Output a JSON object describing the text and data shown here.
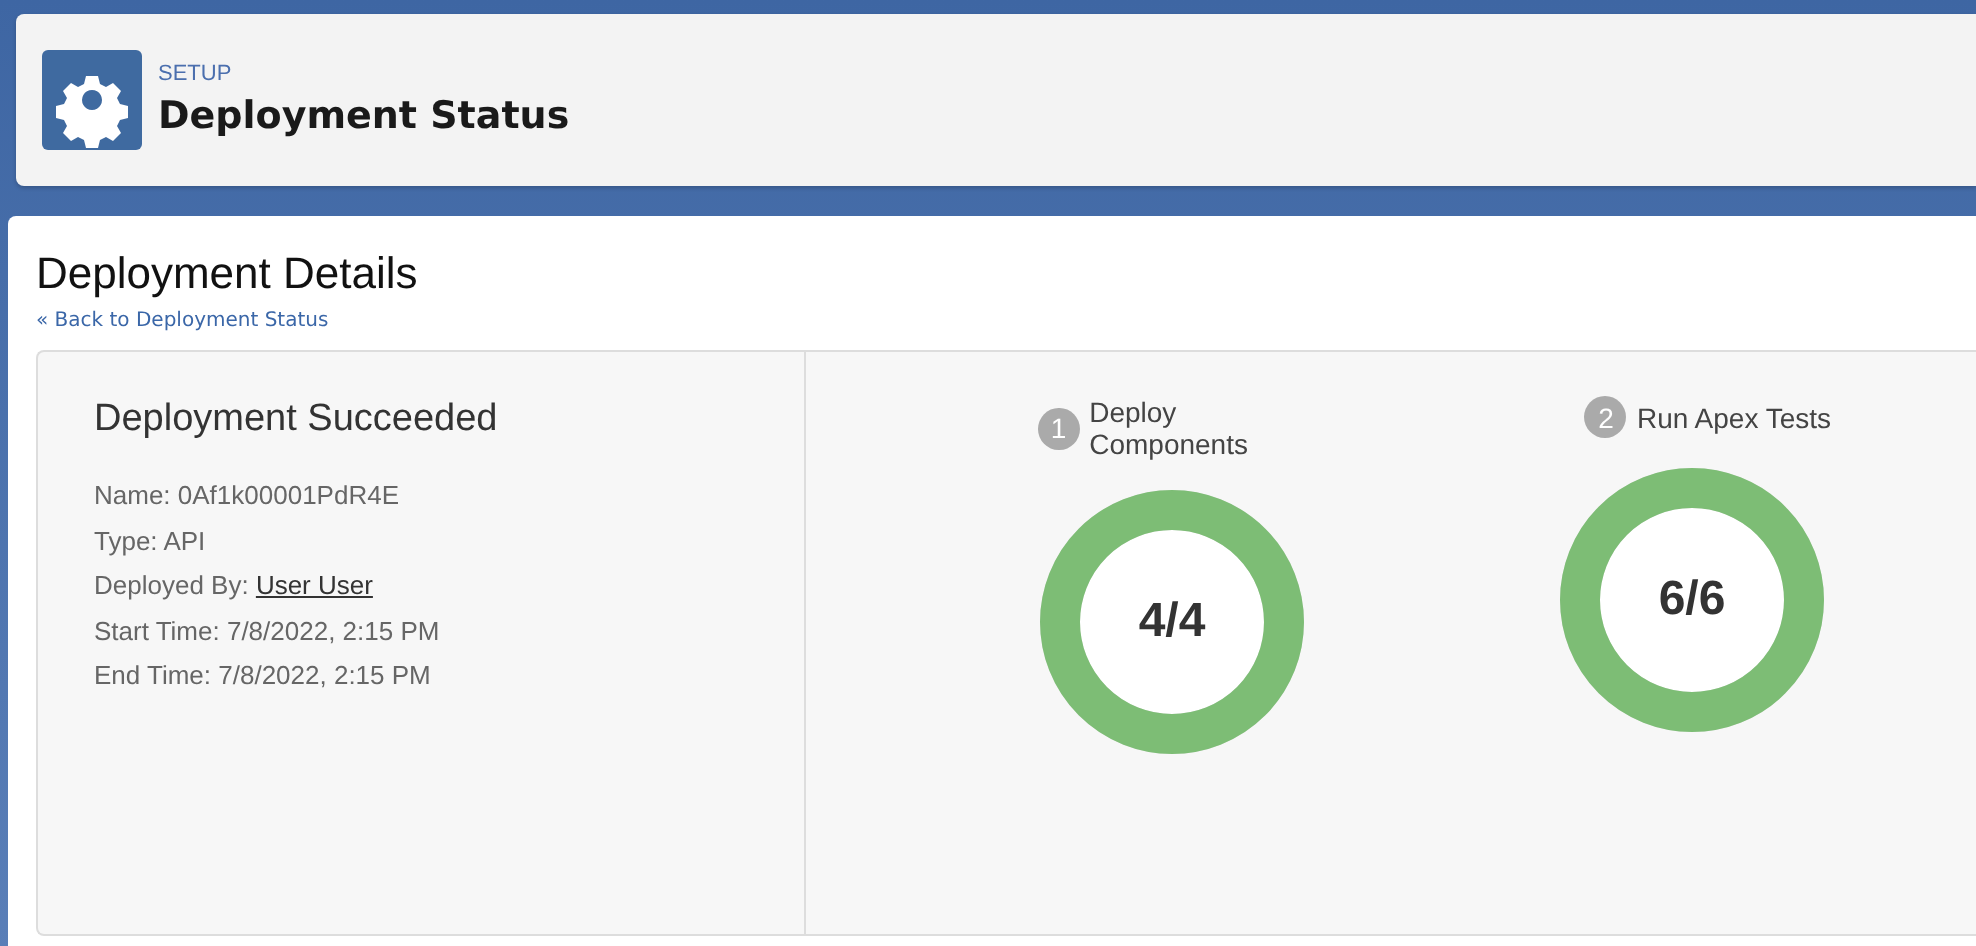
{
  "header": {
    "eyebrow": "SETUP",
    "title": "Deployment Status"
  },
  "page": {
    "title": "Deployment Details",
    "back_link": "« Back to Deployment Status"
  },
  "summary": {
    "title": "Deployment Succeeded",
    "details": [
      {
        "label": "Name:",
        "value": "0Af1k00001PdR4E",
        "kind": "text"
      },
      {
        "label": "Type:",
        "value": "API",
        "kind": "text"
      },
      {
        "label": "Deployed By:",
        "value": "User User",
        "kind": "link"
      },
      {
        "label": "Start Time:",
        "value": "7/8/2022, 2:15 PM",
        "kind": "text"
      },
      {
        "label": "End Time:",
        "value": "7/8/2022, 2:15 PM",
        "kind": "text"
      }
    ]
  },
  "stages": [
    {
      "number": "1",
      "label": "Deploy Components",
      "count": "4/4",
      "level": 1
    },
    {
      "number": "2",
      "label": "Run Apex Tests",
      "count": "6/6",
      "level": 1
    }
  ]
}
